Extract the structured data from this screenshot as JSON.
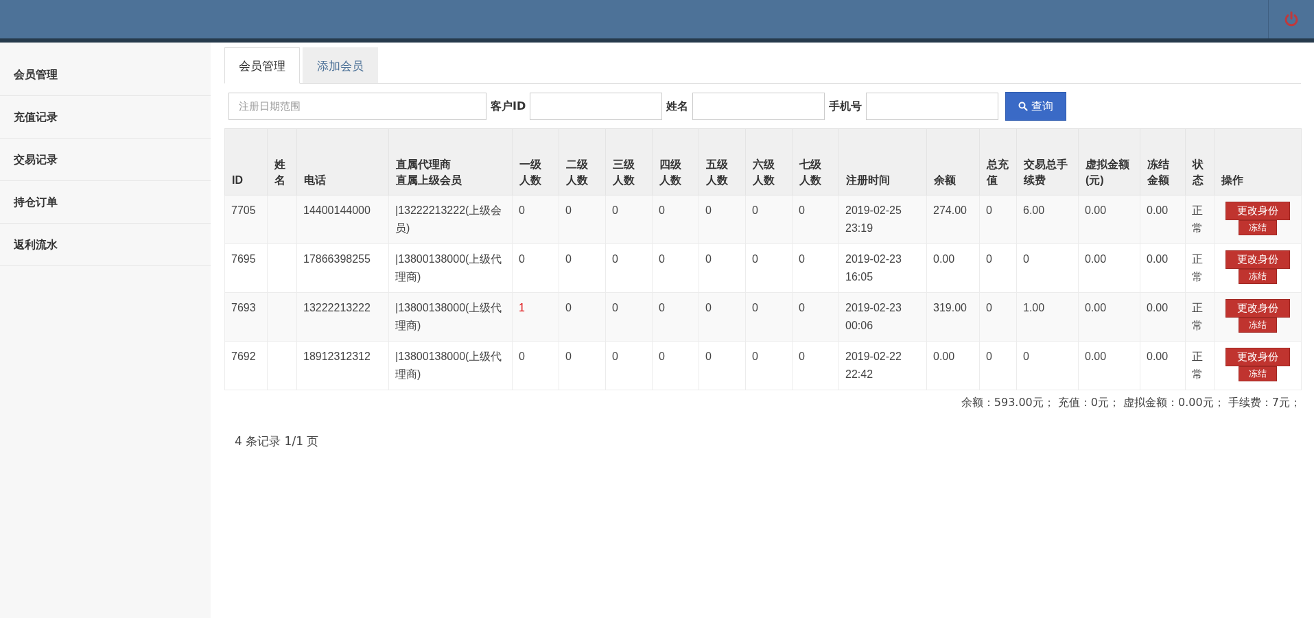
{
  "sidebar": {
    "items": [
      {
        "label": "会员管理"
      },
      {
        "label": "充值记录"
      },
      {
        "label": "交易记录"
      },
      {
        "label": "持仓订单"
      },
      {
        "label": "返利流水"
      }
    ]
  },
  "tabs": [
    {
      "label": "会员管理",
      "selected": true
    },
    {
      "label": "添加会员",
      "selected": false
    }
  ],
  "filters": [
    {
      "kind": "date_range",
      "placeholder": "注册日期范围"
    },
    {
      "kind": "label",
      "text": "客户ID"
    },
    {
      "kind": "field"
    },
    {
      "kind": "label",
      "text": "姓名"
    },
    {
      "kind": "field"
    },
    {
      "kind": "label",
      "text": "手机号"
    },
    {
      "kind": "field"
    },
    {
      "kind": "button",
      "text": "查询"
    }
  ],
  "table": {
    "columns": [
      "ID",
      "姓名",
      "电话",
      [
        "直属代理商",
        "直属上级会员"
      ],
      "一级人数",
      "二级人数",
      "三级人数",
      "四级人数",
      "五级人数",
      "六级人数",
      "七级人数",
      "注册时间",
      "余额",
      "总充值",
      "交易总手续费",
      "虚拟金额(元)",
      "冻结金额",
      "状态",
      "操作"
    ],
    "rows": [
      {
        "id": "7705",
        "phone": "14400144000",
        "parent": "|13222213222(上级会员)",
        "levels": [
          {
            "text": "0",
            "highlighted": false
          },
          {
            "text": "0",
            "highlighted": false
          },
          {
            "text": "0",
            "highlighted": false
          },
          {
            "text": "0",
            "highlighted": false
          },
          {
            "text": "0",
            "highlighted": false
          },
          {
            "text": "0",
            "highlighted": false
          },
          {
            "text": "0",
            "highlighted": false
          }
        ],
        "registered": "2019-02-25 23:19",
        "balance": "274.00",
        "recharge": "0",
        "fee": "6.00",
        "virtual": "0.00",
        "frozen": "0.00",
        "status": "正常",
        "actions": [
          "更改身份",
          "冻结"
        ]
      },
      {
        "id": "7695",
        "phone": "17866398255",
        "parent": "|13800138000(上级代理商)",
        "levels": [
          {
            "text": "0",
            "highlighted": false
          },
          {
            "text": "0",
            "highlighted": false
          },
          {
            "text": "0",
            "highlighted": false
          },
          {
            "text": "0",
            "highlighted": false
          },
          {
            "text": "0",
            "highlighted": false
          },
          {
            "text": "0",
            "highlighted": false
          },
          {
            "text": "0",
            "highlighted": false
          }
        ],
        "registered": "2019-02-23 16:05",
        "balance": "0.00",
        "recharge": "0",
        "fee": "0",
        "virtual": "0.00",
        "frozen": "0.00",
        "status": "正常",
        "actions": [
          "更改身份",
          "冻结"
        ]
      },
      {
        "id": "7693",
        "phone": "13222213222",
        "parent": "|13800138000(上级代理商)",
        "levels": [
          {
            "text": "1",
            "highlighted": true
          },
          {
            "text": "0",
            "highlighted": false
          },
          {
            "text": "0",
            "highlighted": false
          },
          {
            "text": "0",
            "highlighted": false
          },
          {
            "text": "0",
            "highlighted": false
          },
          {
            "text": "0",
            "highlighted": false
          },
          {
            "text": "0",
            "highlighted": false
          }
        ],
        "registered": "2019-02-23 00:06",
        "balance": "319.00",
        "recharge": "0",
        "fee": "1.00",
        "virtual": "0.00",
        "frozen": "0.00",
        "status": "正常",
        "actions": [
          "更改身份",
          "冻结"
        ]
      },
      {
        "id": "7692",
        "phone": "18912312312",
        "parent": "|13800138000(上级代理商)",
        "levels": [
          {
            "text": "0",
            "highlighted": false
          },
          {
            "text": "0",
            "highlighted": false
          },
          {
            "text": "0",
            "highlighted": false
          },
          {
            "text": "0",
            "highlighted": false
          },
          {
            "text": "0",
            "highlighted": false
          },
          {
            "text": "0",
            "highlighted": false
          },
          {
            "text": "0",
            "highlighted": false
          }
        ],
        "registered": "2019-02-22 22:42",
        "balance": "0.00",
        "recharge": "0",
        "fee": "0",
        "virtual": "0.00",
        "frozen": "0.00",
        "status": "正常",
        "actions": [
          "更改身份",
          "冻结"
        ]
      }
    ]
  },
  "summary": "余额：593.00元；  充值：0元；  虚拟金额：0.00元；  手续费：7元；",
  "pagination": "4 条记录 1/1 页"
}
